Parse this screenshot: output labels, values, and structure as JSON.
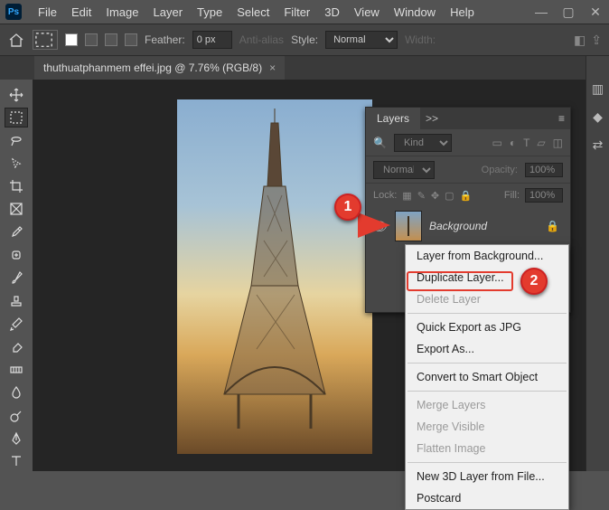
{
  "app": {
    "logo_text": "Ps"
  },
  "menu": {
    "file": "File",
    "edit": "Edit",
    "image": "Image",
    "layer": "Layer",
    "type": "Type",
    "select": "Select",
    "filter": "Filter",
    "threeD": "3D",
    "view": "View",
    "window": "Window",
    "help": "Help"
  },
  "win": {
    "min": "—",
    "max": "▢",
    "close": "✕"
  },
  "optbar": {
    "feather_label": "Feather:",
    "feather_value": "0 px",
    "antialias": "Anti-alias",
    "style_label": "Style:",
    "style_value": "Normal",
    "width_label": "Width:"
  },
  "doc": {
    "tab_title": "thuthuatphanmem effei.jpg @ 7.76% (RGB/8)",
    "tab_close": "×"
  },
  "layers": {
    "panel_title": "Layers",
    "chevrons": ">>",
    "menu_icon": "≡",
    "kind": "Kind",
    "blend": "Normal",
    "opacity_label": "Opacity:",
    "opacity_value": "100%",
    "lock_label": "Lock:",
    "fill_label": "Fill:",
    "fill_value": "100%",
    "layer_name": "Background"
  },
  "markers": {
    "one": "1",
    "two": "2"
  },
  "context_menu": {
    "items": [
      {
        "label": "Layer from Background...",
        "disabled": false
      },
      {
        "label": "Duplicate Layer...",
        "disabled": false,
        "highlight": true
      },
      {
        "label": "Delete Layer",
        "disabled": true
      },
      "---",
      {
        "label": "Quick Export as JPG",
        "disabled": false
      },
      {
        "label": "Export As...",
        "disabled": false
      },
      "---",
      {
        "label": "Convert to Smart Object",
        "disabled": false
      },
      "---",
      {
        "label": "Merge Layers",
        "disabled": true
      },
      {
        "label": "Merge Visible",
        "disabled": true
      },
      {
        "label": "Flatten Image",
        "disabled": true
      },
      "---",
      {
        "label": "New 3D Layer from File...",
        "disabled": false
      },
      {
        "label": "Postcard",
        "disabled": false
      }
    ]
  }
}
